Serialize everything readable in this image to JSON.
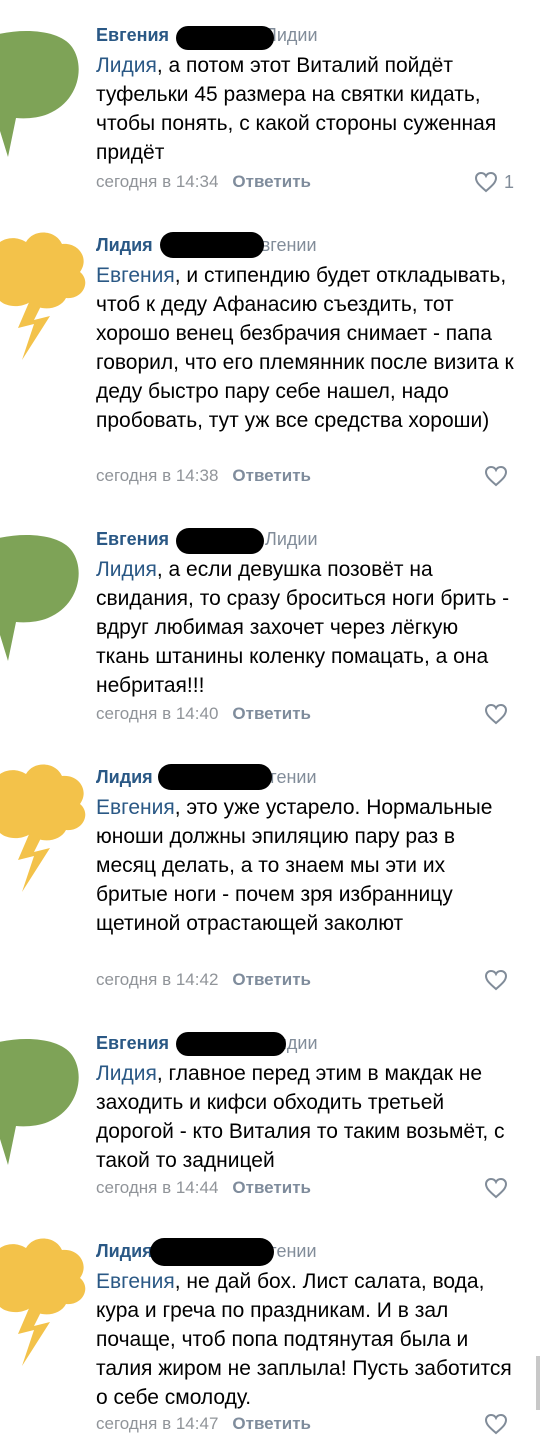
{
  "comments": [
    {
      "author": "Евгения",
      "reply_to": "Лидии",
      "avatar": "green-speech-bubble",
      "mention": "Лидия",
      "text": ", а потом этот Виталий пойдёт туфельки 45 размера на святки кидать, чтобы понять, с какой стороны суженная придёт",
      "time": "сегодня в 14:34",
      "reply_label": "Ответить",
      "likes": "1"
    },
    {
      "author": "Лидия",
      "reply_to": "Евгении",
      "avatar": "yellow-lightning-cloud",
      "mention": "Евгения",
      "text": ", и стипендию будет откладывать, чтоб к деду Афанасию съездить, тот хорошо венец безбрачия снимает - папа говорил, что его племянник после визита к деду быстро пару себе нашел, надо пробовать, тут уж все средства хороши)",
      "time": "сегодня в 14:38",
      "reply_label": "Ответить",
      "likes": ""
    },
    {
      "author": "Евгения",
      "reply_to": "Лидии",
      "avatar": "green-speech-bubble",
      "mention": "Лидия",
      "text": ", а если девушка позовёт на свидания, то сразу броситься ноги брить - вдруг любимая захочет через лёгкую ткань штанины коленку помацать, а она небритая!!!",
      "time": "сегодня в 14:40",
      "reply_label": "Ответить",
      "likes": ""
    },
    {
      "author": "Лидия",
      "reply_to": "Евгении",
      "avatar": "yellow-lightning-cloud",
      "mention": "Евгения",
      "text": ", это уже устарело. Нормальные юноши должны эпиляцию пару раз в месяц делать, а то знаем мы эти их бритые ноги - почем зря избранницу щетиной отрастающей заколют",
      "time": "сегодня в 14:42",
      "reply_label": "Ответить",
      "likes": ""
    },
    {
      "author": "Евгения",
      "reply_to": "Лидии",
      "avatar": "green-speech-bubble",
      "mention": "Лидия",
      "text": ", главное перед этим в макдак не заходить и кифси обходить третьей дорогой - кто Виталия то таким возьмёт, с такой то задницей",
      "time": "сегодня в 14:44",
      "reply_label": "Ответить",
      "likes": ""
    },
    {
      "author": "Лидия",
      "reply_to": "Евгении",
      "avatar": "yellow-lightning-cloud",
      "mention": "Евгения",
      "text": ", не дай бох. Лист салата, вода, кура и греча по праздникам. И в зал почаще, чтоб попа подтянутая была и талия жиром не заплыла! Пусть заботится о себе смолоду.",
      "time": "сегодня в 14:47",
      "reply_label": "Ответить",
      "likes": ""
    }
  ],
  "colors": {
    "link": "#2a5885",
    "meta": "#909499",
    "green_avatar": "#7ea357",
    "yellow_avatar": "#f3c24a"
  }
}
